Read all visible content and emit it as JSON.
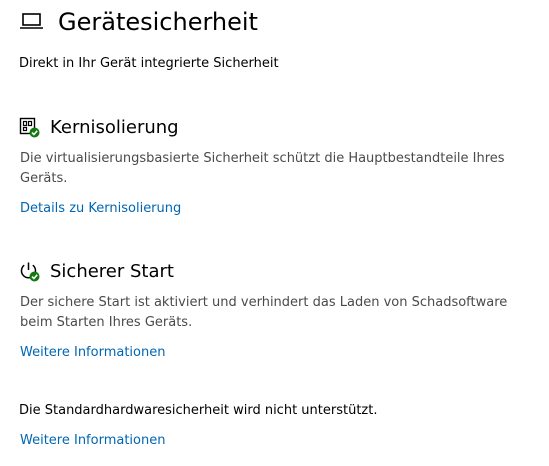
{
  "header": {
    "title": "Gerätesicherheit",
    "subtitle": "Direkt in Ihr Gerät integrierte Sicherheit"
  },
  "core_isolation": {
    "heading": "Kernisolierung",
    "description": "Die virtualisierungsbasierte Sicherheit schützt die Hauptbestandteile Ihres Geräts.",
    "link": "Details zu Kernisolierung",
    "icon": "core-isolation-chip-icon"
  },
  "secure_boot": {
    "heading": "Sicherer Start",
    "description": "Der sichere Start ist aktiviert und verhindert das Laden von Schadsoftware beim Starten Ihres Geräts.",
    "link": "Weitere Informationen",
    "icon": "power-check-icon"
  },
  "hardware_security": {
    "status_text": "Die Standardhardwaresicherheit wird nicht unterstützt.",
    "link": "Weitere Informationen"
  },
  "colors": {
    "link": "#0066b4",
    "ok_badge": "#107c10",
    "text": "#000000",
    "secondary_text": "#4a4a4a"
  }
}
